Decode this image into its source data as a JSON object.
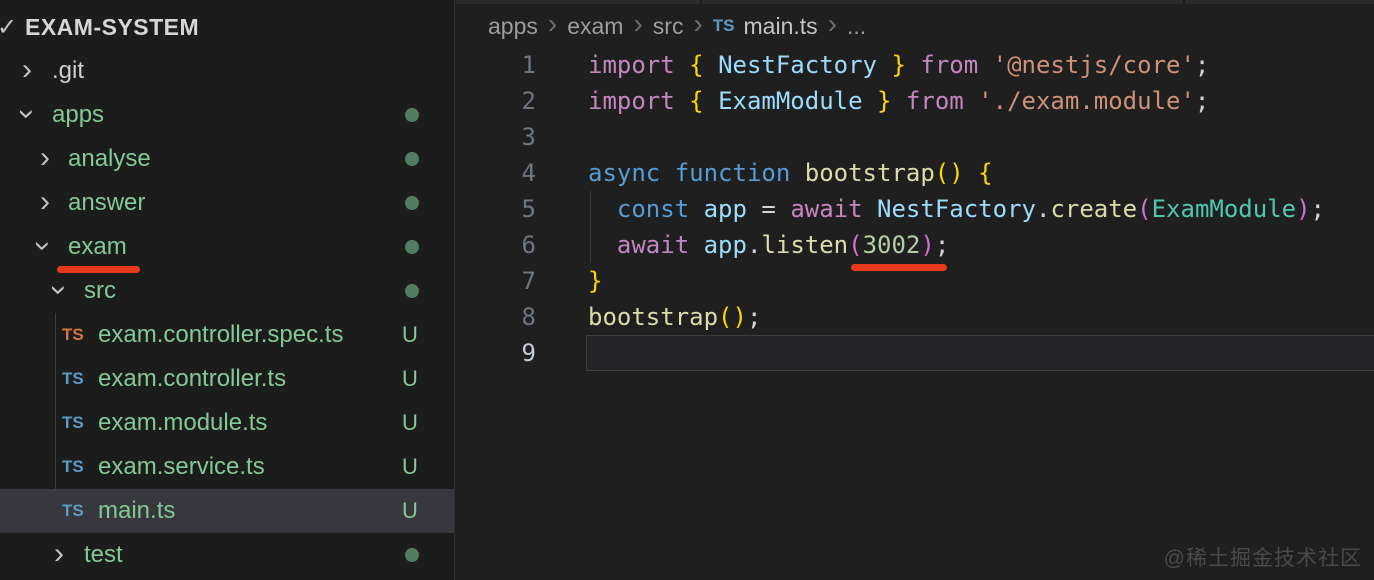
{
  "colors": {
    "editor_background": "#1f1f1f",
    "sidebar_background": "#1c1c1c",
    "selected_row": "#37373d",
    "git_green": "#81c995",
    "badge_dot_green": "#537d60",
    "ts_icon_blue": "#5c9bc5",
    "ts_icon_orange": "#d4763f",
    "annotation_red": "#e8391d",
    "syntax_keyword_purple": "#c586c0",
    "syntax_keyword_blue": "#569cd6",
    "syntax_variable": "#9cdcfe",
    "syntax_function": "#dcdcaa",
    "syntax_class": "#4ec9b0",
    "syntax_string": "#ce9178",
    "syntax_number": "#b5cea8",
    "bracket_gold": "#ffd700",
    "bracket_orchid": "#d670d6"
  },
  "sidebar": {
    "root_label": "EXAM-SYSTEM",
    "ts_icon_label": "TS",
    "items": [
      {
        "label": ".git",
        "type": "folder",
        "chevron": "right",
        "badge": ""
      },
      {
        "label": "apps",
        "type": "folder",
        "chevron": "down",
        "badge": "dot"
      },
      {
        "label": "analyse",
        "type": "folder",
        "chevron": "right",
        "badge": "dot"
      },
      {
        "label": "answer",
        "type": "folder",
        "chevron": "right",
        "badge": "dot"
      },
      {
        "label": "exam",
        "type": "folder",
        "chevron": "down",
        "badge": "dot",
        "annotated": "red-underline"
      },
      {
        "label": "src",
        "type": "folder",
        "chevron": "down",
        "badge": "dot"
      },
      {
        "label": "exam.controller.spec.ts",
        "type": "file",
        "icon": "ts-orange",
        "badge": "U"
      },
      {
        "label": "exam.controller.ts",
        "type": "file",
        "icon": "ts-blue",
        "badge": "U"
      },
      {
        "label": "exam.module.ts",
        "type": "file",
        "icon": "ts-blue",
        "badge": "U"
      },
      {
        "label": "exam.service.ts",
        "type": "file",
        "icon": "ts-blue",
        "badge": "U"
      },
      {
        "label": "main.ts",
        "type": "file",
        "icon": "ts-blue",
        "badge": "U",
        "selected": true
      },
      {
        "label": "test",
        "type": "folder",
        "chevron": "right",
        "badge": "dot"
      }
    ]
  },
  "editor": {
    "ts_icon_label": "TS",
    "breadcrumb": {
      "items": [
        "apps",
        "exam",
        "src",
        "main.ts"
      ],
      "ellipsis": "..."
    },
    "active_line": 9,
    "lines": [
      {
        "num": "1",
        "tokens": [
          [
            "kwp",
            "import"
          ],
          [
            "pln",
            " "
          ],
          [
            "b1",
            "{"
          ],
          [
            "pln",
            " "
          ],
          [
            "var",
            "NestFactory"
          ],
          [
            "pln",
            " "
          ],
          [
            "b1",
            "}"
          ],
          [
            "pln",
            " "
          ],
          [
            "kwp",
            "from"
          ],
          [
            "pln",
            " "
          ],
          [
            "str",
            "'@nestjs/core'"
          ],
          [
            "pln",
            ";"
          ]
        ]
      },
      {
        "num": "2",
        "tokens": [
          [
            "kwp",
            "import"
          ],
          [
            "pln",
            " "
          ],
          [
            "b1",
            "{"
          ],
          [
            "pln",
            " "
          ],
          [
            "var",
            "ExamModule"
          ],
          [
            "pln",
            " "
          ],
          [
            "b1",
            "}"
          ],
          [
            "pln",
            " "
          ],
          [
            "kwp",
            "from"
          ],
          [
            "pln",
            " "
          ],
          [
            "str",
            "'./exam.module'"
          ],
          [
            "pln",
            ";"
          ]
        ]
      },
      {
        "num": "3",
        "tokens": []
      },
      {
        "num": "4",
        "tokens": [
          [
            "kwb",
            "async"
          ],
          [
            "pln",
            " "
          ],
          [
            "kwb",
            "function"
          ],
          [
            "pln",
            " "
          ],
          [
            "fn",
            "bootstrap"
          ],
          [
            "b1",
            "()"
          ],
          [
            "pln",
            " "
          ],
          [
            "b1",
            "{"
          ]
        ]
      },
      {
        "num": "5",
        "tokens": [
          [
            "pln",
            "  "
          ],
          [
            "kwb",
            "const"
          ],
          [
            "pln",
            " "
          ],
          [
            "var",
            "app"
          ],
          [
            "pln",
            " = "
          ],
          [
            "kwp",
            "await"
          ],
          [
            "pln",
            " "
          ],
          [
            "var",
            "NestFactory"
          ],
          [
            "pln",
            "."
          ],
          [
            "fn",
            "create"
          ],
          [
            "b2",
            "("
          ],
          [
            "cls",
            "ExamModule"
          ],
          [
            "b2",
            ")"
          ],
          [
            "pln",
            ";"
          ]
        ]
      },
      {
        "num": "6",
        "tokens": [
          [
            "pln",
            "  "
          ],
          [
            "kwp",
            "await"
          ],
          [
            "pln",
            " "
          ],
          [
            "var",
            "app"
          ],
          [
            "pln",
            "."
          ],
          [
            "fn",
            "listen"
          ],
          [
            "b2",
            "("
          ],
          [
            "num",
            "3002"
          ],
          [
            "b2",
            ")"
          ],
          [
            "pln",
            ";"
          ]
        ],
        "annotated": "red-underline"
      },
      {
        "num": "7",
        "tokens": [
          [
            "b1",
            "}"
          ]
        ]
      },
      {
        "num": "8",
        "tokens": [
          [
            "fn",
            "bootstrap"
          ],
          [
            "b1",
            "()"
          ],
          [
            "pln",
            ";"
          ]
        ]
      },
      {
        "num": "9",
        "tokens": []
      }
    ]
  },
  "watermark": "@稀土掘金技术社区"
}
